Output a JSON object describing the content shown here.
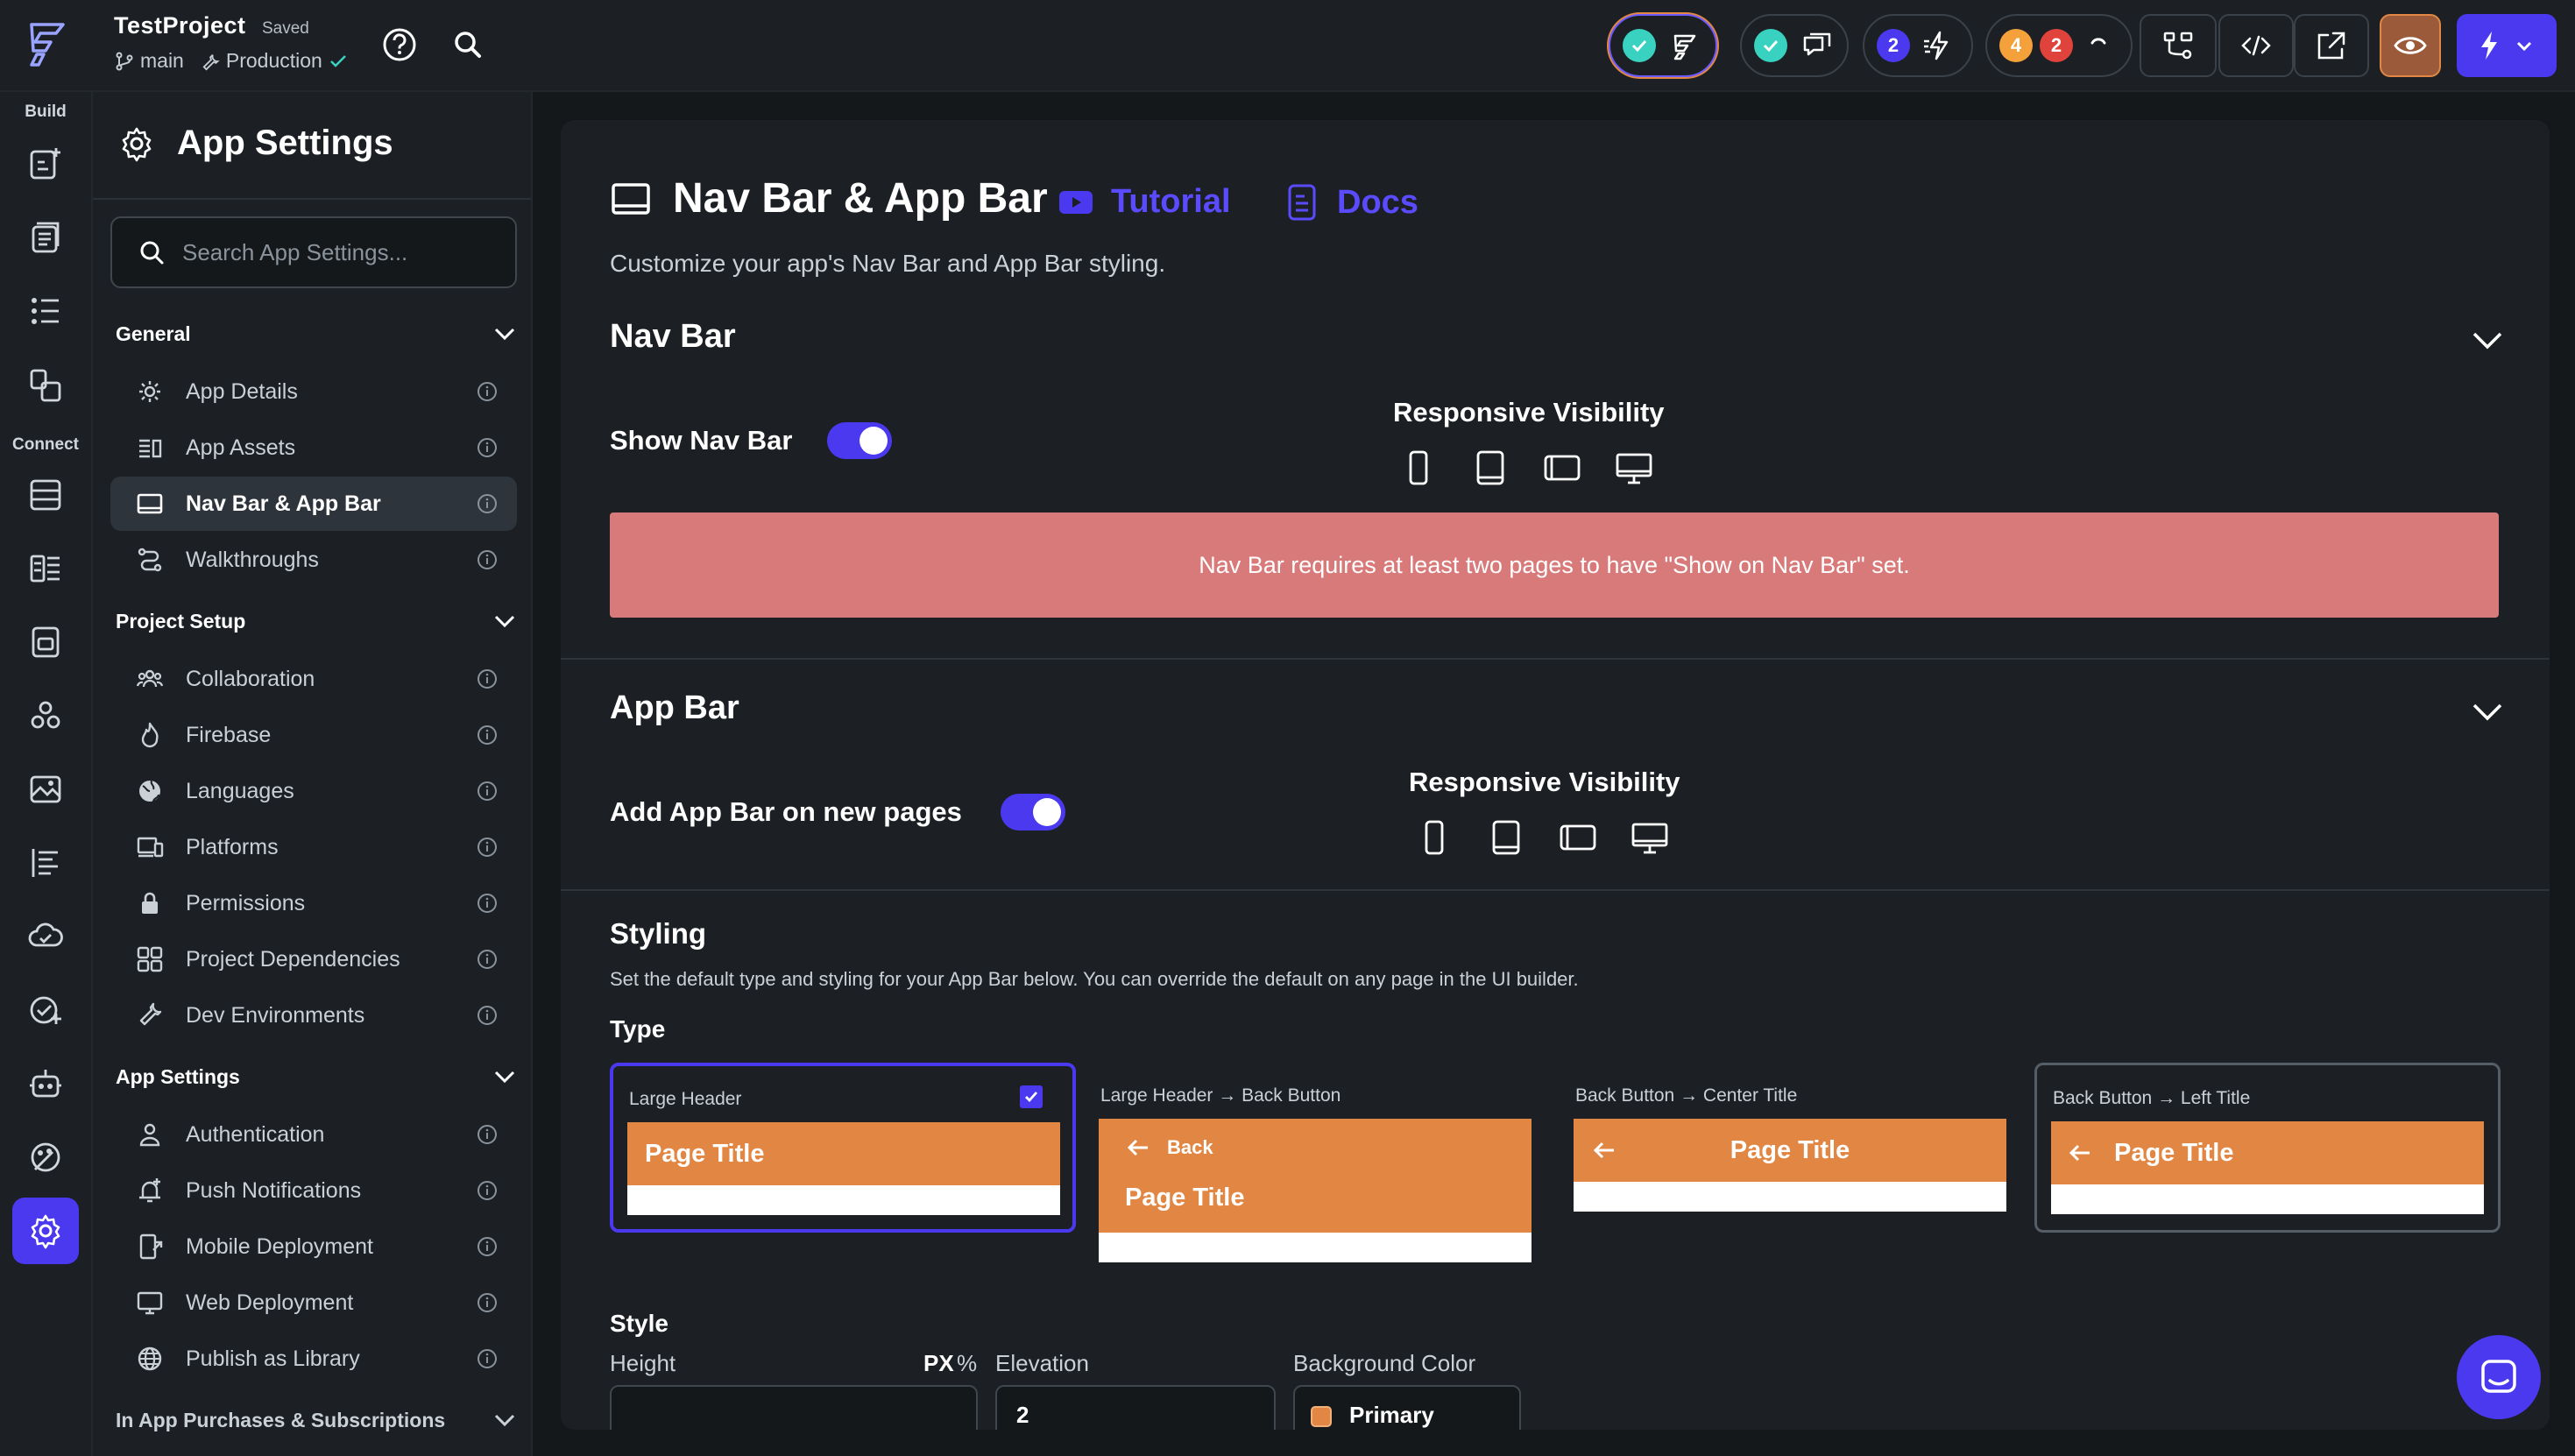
{
  "header": {
    "project_name": "TestProject",
    "saved_status": "Saved",
    "branch": "main",
    "environment": "Production",
    "badges": {
      "collab_count": "2",
      "warnings_count": "4",
      "errors_count": "2"
    }
  },
  "rail": {
    "build_label": "Build",
    "connect_label": "Connect"
  },
  "sidebar": {
    "title": "App Settings",
    "search_placeholder": "Search App Settings...",
    "groups": {
      "general": "General",
      "project_setup": "Project Setup",
      "app_settings": "App Settings",
      "iap": "In App Purchases & Subscriptions"
    },
    "items": {
      "app_details": "App Details",
      "app_assets": "App Assets",
      "nav_app_bar": "Nav Bar & App Bar",
      "walkthroughs": "Walkthroughs",
      "collaboration": "Collaboration",
      "firebase": "Firebase",
      "languages": "Languages",
      "platforms": "Platforms",
      "permissions": "Permissions",
      "project_dependencies": "Project Dependencies",
      "dev_environments": "Dev Environments",
      "authentication": "Authentication",
      "push_notifications": "Push Notifications",
      "mobile_deployment": "Mobile Deployment",
      "web_deployment": "Web Deployment",
      "publish_library": "Publish as Library"
    }
  },
  "main": {
    "title": "Nav Bar & App Bar",
    "tutorial_label": "Tutorial",
    "docs_label": "Docs",
    "subtitle": "Customize your app's Nav Bar and App Bar styling.",
    "nav_bar": {
      "title": "Nav Bar",
      "show_label": "Show Nav Bar",
      "show_enabled": true,
      "responsive_title": "Responsive Visibility",
      "warning": "Nav Bar requires at least two pages to have \"Show on Nav Bar\" set."
    },
    "app_bar": {
      "title": "App Bar",
      "add_label": "Add App Bar on new pages",
      "add_enabled": true,
      "responsive_title": "Responsive Visibility"
    },
    "styling": {
      "title": "Styling",
      "subtitle": "Set the default type and styling for your App Bar below. You can override the default on any page in the UI builder.",
      "type_label": "Type",
      "types": [
        {
          "label": "Large Header",
          "preview_title": "Page Title",
          "selected": true
        },
        {
          "label": "Large Header → Back Button",
          "back_label": "Back",
          "preview_title": "Page Title",
          "selected": false
        },
        {
          "label": "Back Button → Center Title",
          "preview_title": "Page Title",
          "selected": false
        },
        {
          "label": "Back Button → Left Title",
          "preview_title": "Page Title",
          "selected": false
        }
      ],
      "style_label": "Style",
      "height_label": "Height",
      "unit_px": "PX",
      "unit_pct": "%",
      "elevation_label": "Elevation",
      "elevation_value": "2",
      "bg_color_label": "Background Color",
      "bg_color_value": "Primary"
    }
  },
  "colors": {
    "accent": "#4b39ef",
    "appbar_preview": "#e28743",
    "warning_bg": "#d97a7a",
    "success": "#39d2c0",
    "warning_badge": "#f4a13b",
    "error_badge": "#e0433c"
  }
}
